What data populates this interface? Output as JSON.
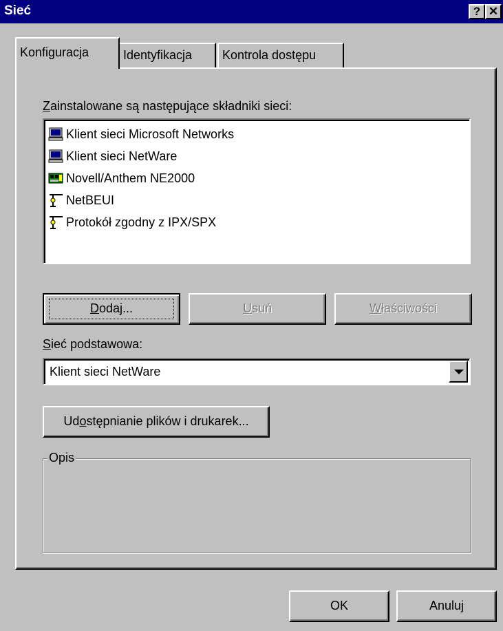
{
  "window": {
    "title": "Sieć",
    "help_label": "?",
    "close_label": "✕"
  },
  "tabs": [
    {
      "label": "Konfiguracja",
      "active": true
    },
    {
      "label": "Identyfikacja",
      "active": false
    },
    {
      "label": "Kontrola dostępu",
      "active": false
    }
  ],
  "components": {
    "label_ul": "Z",
    "label_rest": "ainstalowane są następujące składniki sieci:",
    "items": [
      {
        "label": "Klient sieci Microsoft Networks",
        "icon": "client-icon"
      },
      {
        "label": "Klient sieci NetWare",
        "icon": "client-icon"
      },
      {
        "label": "Novell/Anthem NE2000",
        "icon": "adapter-icon"
      },
      {
        "label": "NetBEUI",
        "icon": "protocol-icon"
      },
      {
        "label": "Protokół zgodny z IPX/SPX",
        "icon": "protocol-icon"
      }
    ]
  },
  "buttons": {
    "add_ul": "D",
    "add_rest": "odaj...",
    "remove_ul": "U",
    "remove_rest": "suń",
    "props_ul": "W",
    "props_rest": "łaściwości",
    "share_pre": "Ud",
    "share_ul": "o",
    "share_rest": "stępnianie plików i drukarek...",
    "ok": "OK",
    "cancel": "Anuluj"
  },
  "primary_network": {
    "label_ul": "S",
    "label_rest": "ieć podstawowa:",
    "value": "Klient sieci NetWare"
  },
  "description": {
    "label": "Opis"
  }
}
